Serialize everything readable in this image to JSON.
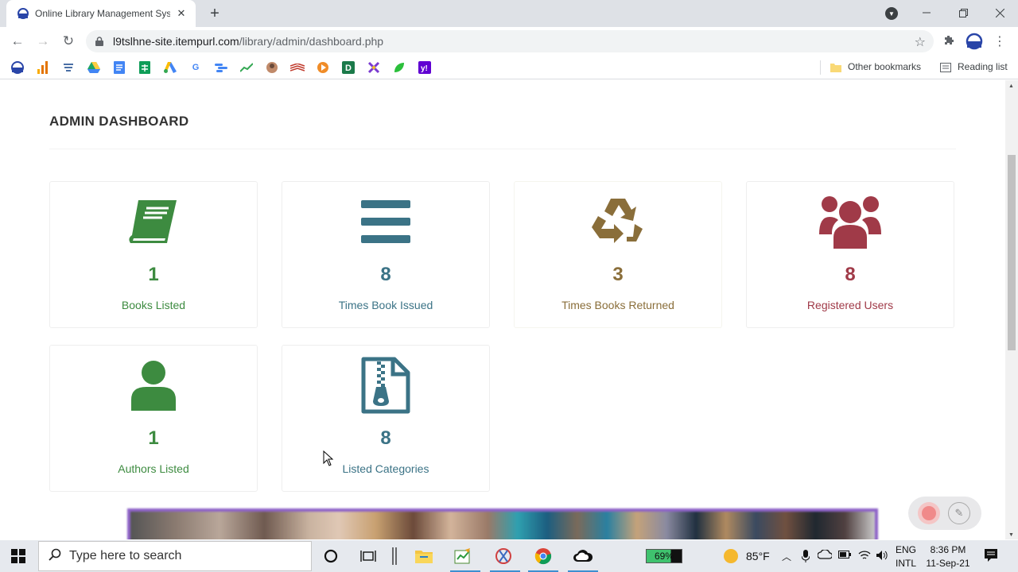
{
  "browser": {
    "tab_title": "Online Library Management System",
    "url_host": "l9tslhne-site.itempurl.com",
    "url_path": "/library/admin/dashboard.php",
    "bookmarks": {
      "other_label": "Other bookmarks",
      "reading_list_label": "Reading list",
      "icons": [
        "profile-icon",
        "analytics-icon",
        "shield-icon",
        "drive-icon",
        "docs-icon",
        "sheets-icon",
        "ads-icon",
        "google-icon",
        "dots-icon",
        "trend-icon",
        "avatar-icon",
        "bank-icon",
        "play-icon",
        "d-icon",
        "x-icon",
        "leaf-icon",
        "yahoo-icon"
      ]
    }
  },
  "dashboard": {
    "title": "ADMIN DASHBOARD",
    "cards": [
      {
        "value": "1",
        "label": "Books Listed",
        "color": "#3d8b40",
        "icon": "book-icon"
      },
      {
        "value": "8",
        "label": "Times Book Issued",
        "color": "#3b7386",
        "icon": "bars-icon"
      },
      {
        "value": "3",
        "label": "Times Books Returned",
        "color": "#8a6e3a",
        "icon": "recycle-icon"
      },
      {
        "value": "8",
        "label": "Registered Users",
        "color": "#a03a48",
        "icon": "users-icon"
      },
      {
        "value": "1",
        "label": "Authors Listed",
        "color": "#3d8b40",
        "icon": "user-icon"
      },
      {
        "value": "8",
        "label": "Listed Categories",
        "color": "#3b7386",
        "icon": "zip-file-icon"
      }
    ]
  },
  "taskbar": {
    "search_placeholder": "Type here to search",
    "battery": "69%",
    "temperature": "85°F",
    "lang_top": "ENG",
    "lang_bottom": "INTL",
    "time": "8:36 PM",
    "date": "11-Sep-21"
  }
}
